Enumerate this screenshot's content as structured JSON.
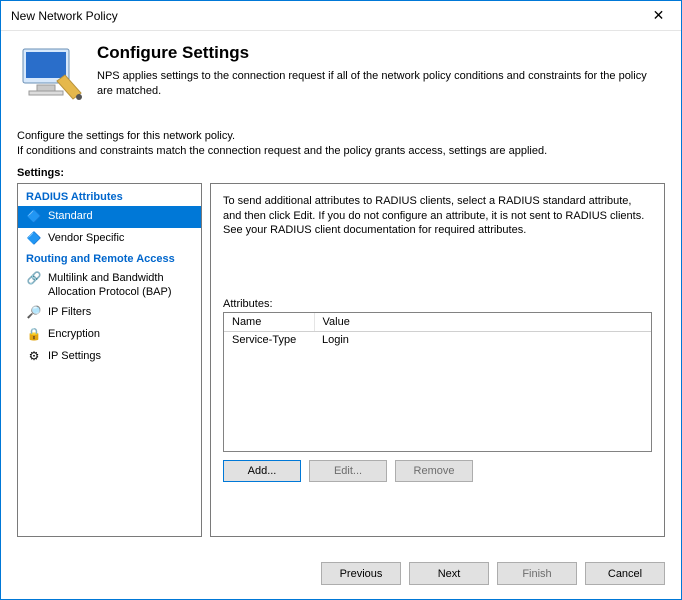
{
  "window": {
    "title": "New Network Policy"
  },
  "header": {
    "title": "Configure Settings",
    "desc": "NPS applies settings to the connection request if all of the network policy conditions and constraints for the policy are matched."
  },
  "instruction": {
    "line1": "Configure the settings for this network policy.",
    "line2": "If conditions and constraints match the connection request and the policy grants access, settings are applied."
  },
  "settings_label": "Settings:",
  "sidebar": {
    "section1": "RADIUS Attributes",
    "items1": [
      {
        "label": "Standard",
        "icon": "🔷"
      },
      {
        "label": "Vendor Specific",
        "icon": "🔷"
      }
    ],
    "section2": "Routing and Remote Access",
    "items2": [
      {
        "label": "Multilink and Bandwidth Allocation Protocol (BAP)",
        "icon": "🔗"
      },
      {
        "label": "IP Filters",
        "icon": "🔎"
      },
      {
        "label": "Encryption",
        "icon": "🔒"
      },
      {
        "label": "IP Settings",
        "icon": "⚙"
      }
    ]
  },
  "main": {
    "help": "To send additional attributes to RADIUS clients, select a RADIUS standard attribute, and then click Edit. If you do not configure an attribute, it is not sent to RADIUS clients. See your RADIUS client documentation for required attributes.",
    "attributes_label": "Attributes:",
    "table": {
      "headers": {
        "name": "Name",
        "value": "Value"
      },
      "rows": [
        {
          "name": "Service-Type",
          "value": "Login"
        }
      ]
    },
    "buttons": {
      "add": "Add...",
      "edit": "Edit...",
      "remove": "Remove"
    }
  },
  "footer": {
    "previous": "Previous",
    "next": "Next",
    "finish": "Finish",
    "cancel": "Cancel"
  }
}
